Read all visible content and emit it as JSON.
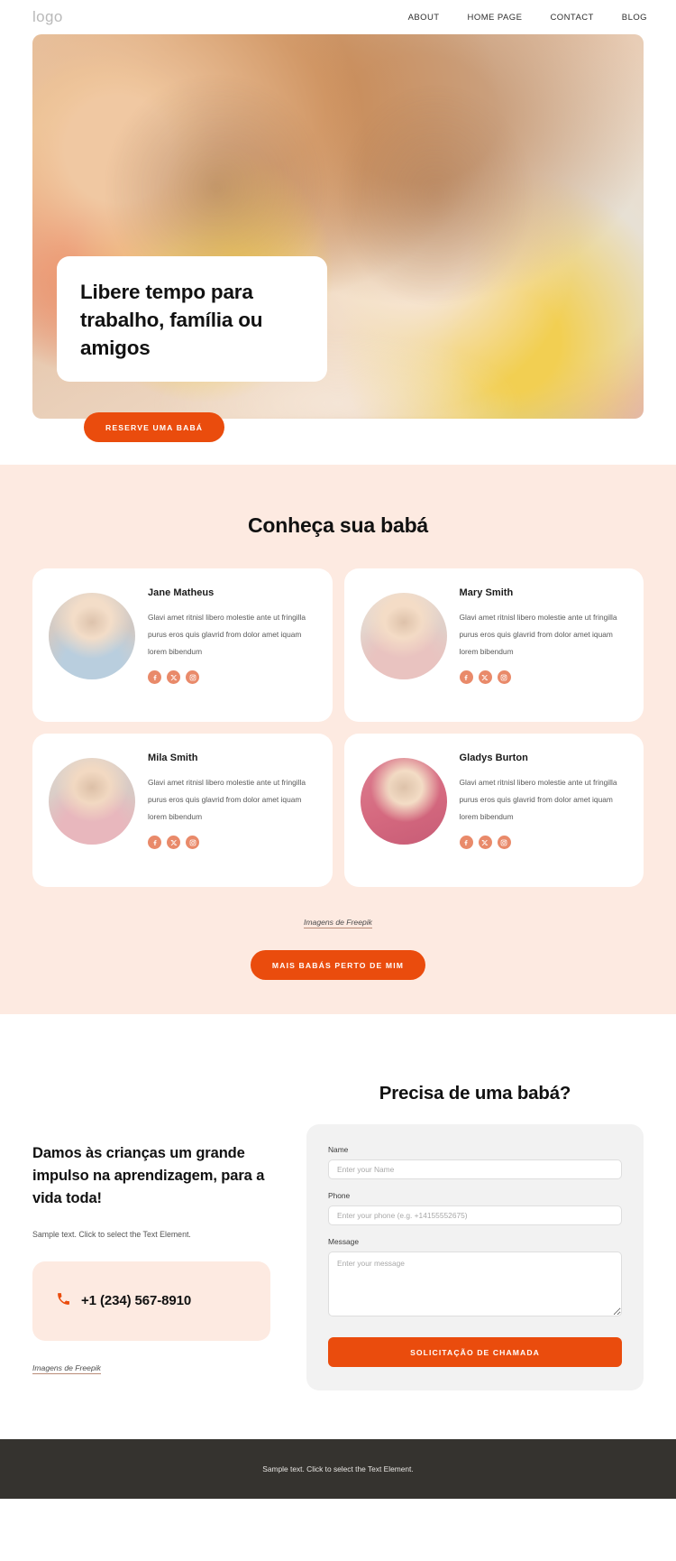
{
  "header": {
    "logo": "logo",
    "nav": [
      {
        "label": "ABOUT"
      },
      {
        "label": "HOME PAGE"
      },
      {
        "label": "CONTACT"
      },
      {
        "label": "BLOG"
      }
    ]
  },
  "hero": {
    "headline": "Libere tempo para trabalho, família ou amigos",
    "cta": "RESERVE UMA BABÁ"
  },
  "nannies": {
    "title": "Conheça sua babá",
    "cards": [
      {
        "name": "Jane Matheus",
        "desc": "Glavi amet ritnisl libero molestie ante ut fringilla purus eros quis glavrid from dolor amet iquam lorem bibendum"
      },
      {
        "name": "Mary Smith",
        "desc": "Glavi amet ritnisl libero molestie ante ut fringilla purus eros quis glavrid from dolor amet iquam lorem bibendum"
      },
      {
        "name": "Mila Smith",
        "desc": "Glavi amet ritnisl libero molestie ante ut fringilla purus eros quis glavrid from dolor amet iquam lorem bibendum"
      },
      {
        "name": "Gladys Burton",
        "desc": "Glavi amet ritnisl libero molestie ante ut fringilla purus eros quis glavrid from dolor amet iquam lorem bibendum"
      }
    ],
    "socials": [
      "facebook-icon",
      "x-twitter-icon",
      "instagram-icon"
    ],
    "credit": "Imagens de Freepik",
    "more_button": "MAIS BABÁS PERTO DE MIM"
  },
  "contact": {
    "heading": "Damos às crianças um grande impulso na aprendizagem, para a vida toda!",
    "subtext": "Sample text. Click to select the Text Element.",
    "phone": "+1 (234) 567-8910",
    "phone_icon": "phone-icon",
    "credit": "Imagens de Freepik",
    "form": {
      "title": "Precisa de uma babá?",
      "fields": [
        {
          "label": "Name",
          "placeholder": "Enter your Name",
          "value": ""
        },
        {
          "label": "Phone",
          "placeholder": "Enter your phone (e.g. +14155552675)",
          "value": ""
        },
        {
          "label": "Message",
          "placeholder": "Enter your message",
          "value": ""
        }
      ],
      "submit": "SOLICITAÇÃO DE CHAMADA"
    }
  },
  "footer": {
    "text": "Sample text. Click to select the Text Element."
  },
  "colors": {
    "accent": "#ea4c0d",
    "soft_pink": "#fdeae1",
    "social": "#e98a6a",
    "footer_bg": "#35332f"
  }
}
